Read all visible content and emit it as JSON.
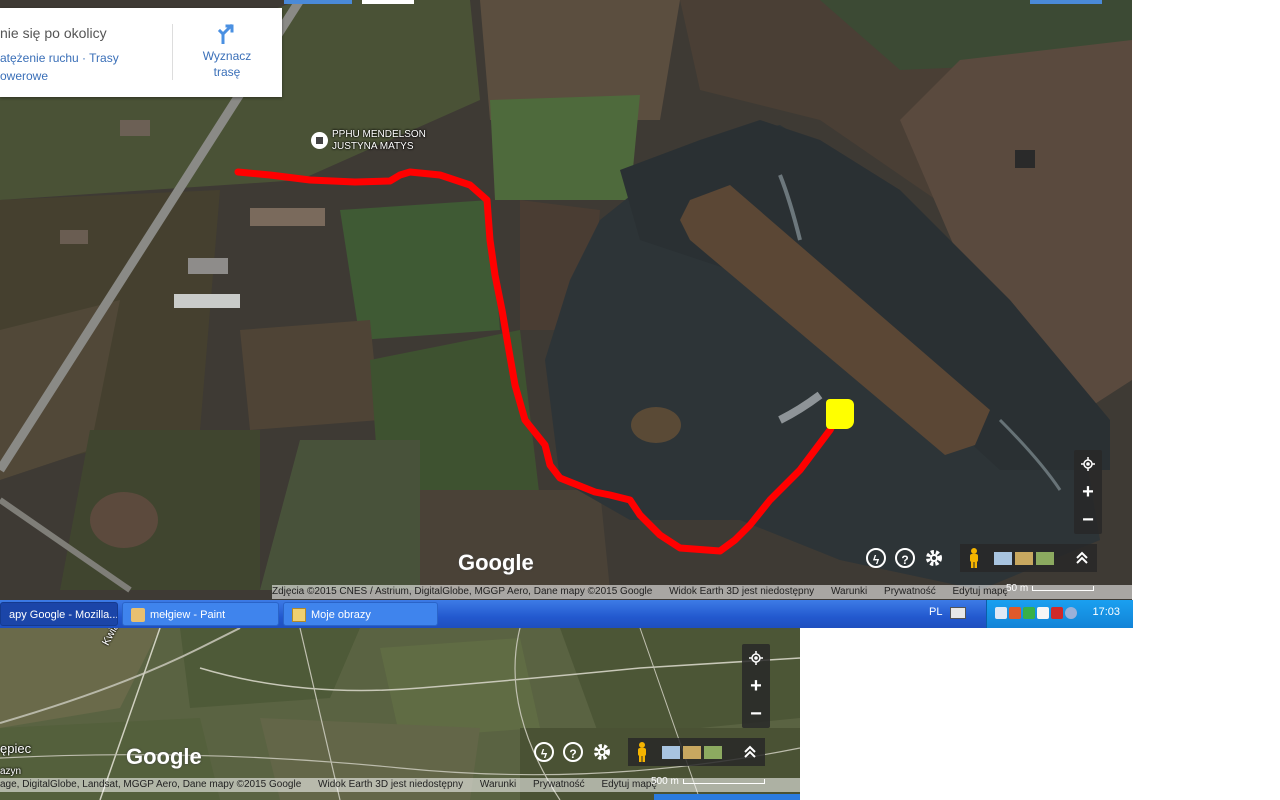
{
  "top_map": {
    "panel": {
      "heading": "nie się po okolicy",
      "links_line1": "atężenie ruchu · Trasy",
      "links_line2": "owerowe",
      "route_label_line1": "Wyznacz",
      "route_label_line2": "trasę"
    },
    "poi": {
      "line1": "PPHU MENDELSON",
      "line2": "JUSTYNA MATYS"
    },
    "logo": "Google",
    "attribution": {
      "imagery": "Zdjęcia ©2015 CNES / Astrium, DigitalGlobe, MGGP Aero, Dane mapy ©2015 Google",
      "earth": "Widok Earth 3D jest niedostępny",
      "terms": "Warunki",
      "privacy": "Prywatność",
      "edit": "Edytuj mapę"
    },
    "scale": "50 m",
    "zoom_in": "+",
    "zoom_out": "−",
    "help": "?",
    "colors": {
      "route": "#ff0000",
      "marker": "#ffff00"
    }
  },
  "taskbar": {
    "tasks": [
      {
        "label": "apy Google - Mozilla...",
        "state": "active"
      },
      {
        "label": "mełgiew - Paint",
        "state": "normal"
      },
      {
        "label": "Moje obrazy",
        "state": "normal"
      }
    ],
    "language": "PL",
    "clock": "17:03"
  },
  "bottom_map": {
    "road_label": "Kwiato",
    "place_label": "ępiec",
    "place_label2": "azyn",
    "logo": "Google",
    "attribution": {
      "imagery": "age, DigitalGlobe, Landsat, MGGP Aero, Dane mapy ©2015 Google",
      "earth": "Widok Earth 3D jest niedostępny",
      "terms": "Warunki",
      "privacy": "Prywatność",
      "edit": "Edytuj mapę"
    },
    "scale": "500 m",
    "zoom_in": "+",
    "zoom_out": "−",
    "help": "?"
  }
}
